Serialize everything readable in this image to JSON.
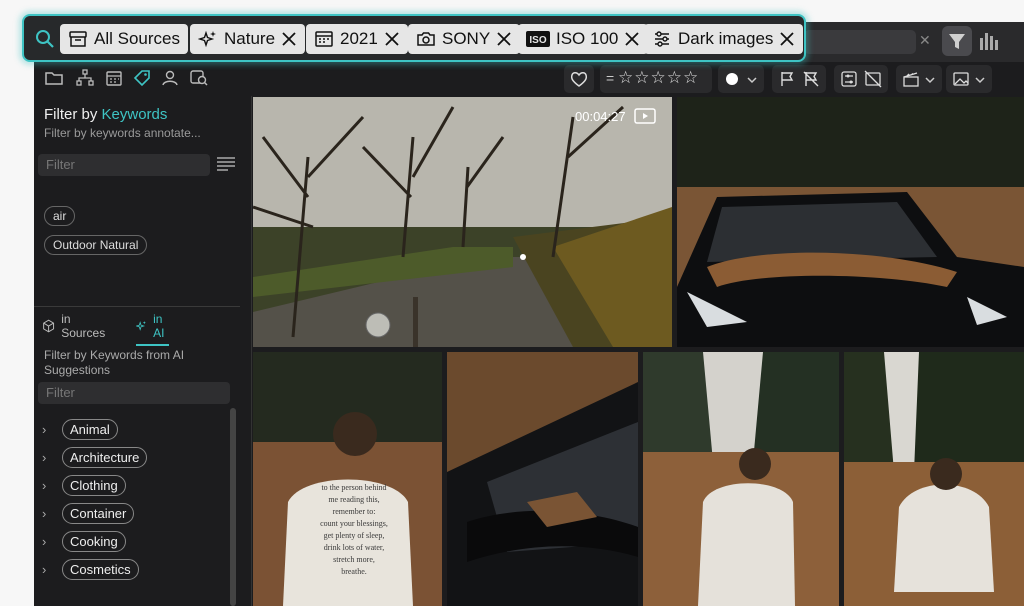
{
  "filter_chips": [
    {
      "label": "All Sources",
      "icon": "archive-icon"
    },
    {
      "label": "Nature",
      "icon": "ai-sparkle-icon"
    },
    {
      "label": "2021",
      "icon": "calendar-icon"
    },
    {
      "label": "SONY",
      "icon": "camera-icon"
    },
    {
      "label": "ISO 100",
      "icon": "iso-icon"
    },
    {
      "label": "Dark images",
      "icon": "adjustments-icon"
    }
  ],
  "sidebar": {
    "title_prefix": "Filter by ",
    "title_accent": "Keywords",
    "subtitle": "Filter by keywords annotate...",
    "filter_placeholder": "Filter",
    "tags": [
      "air",
      "Outdoor Natural"
    ],
    "tabs": [
      {
        "label": "in Sources",
        "active": false
      },
      {
        "label": "in AI",
        "active": true
      }
    ],
    "ai_description": "Filter by Keywords from AI Suggestions",
    "ai_filter_placeholder": "Filter",
    "categories": [
      "Animal",
      "Architecture",
      "Clothing",
      "Container",
      "Cooking",
      "Cosmetics"
    ]
  },
  "video": {
    "duration": "00:04:27"
  },
  "hoodie_text": [
    "to the person behind",
    "me reading this,",
    "remember to:",
    "count your blessings,",
    "get plenty of sleep,",
    "drink lots of water,",
    "stretch more,",
    "breathe."
  ],
  "colors": {
    "accent": "#3ec4c4",
    "chip_bg": "#e6e6e6",
    "app_bg": "#1c1c1e"
  }
}
